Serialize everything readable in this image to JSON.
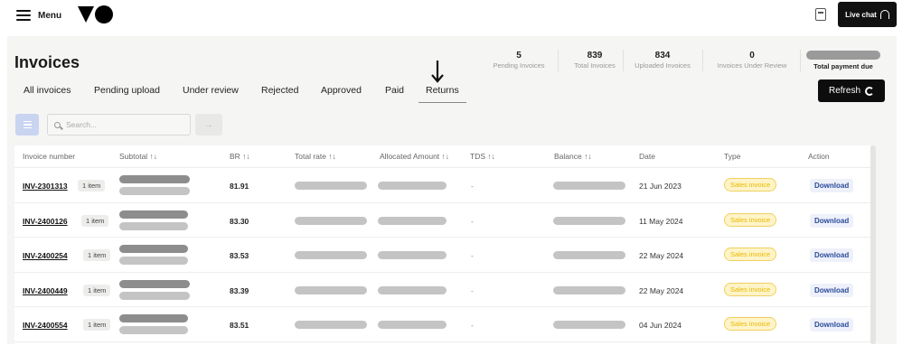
{
  "topbar": {
    "menu_label": "Menu",
    "live_chat_label": "Live chat"
  },
  "page": {
    "title": "Invoices"
  },
  "stats": [
    {
      "value": "5",
      "label": "Pending Invoices"
    },
    {
      "value": "839",
      "label": "Total Invoices"
    },
    {
      "value": "834",
      "label": "Uploaded Invoices"
    },
    {
      "value": "0",
      "label": "Invoices Under Review"
    }
  ],
  "total_payment_label": "Total payment due",
  "tabs": [
    {
      "label": "All invoices"
    },
    {
      "label": "Pending upload"
    },
    {
      "label": "Under review"
    },
    {
      "label": "Rejected"
    },
    {
      "label": "Approved"
    },
    {
      "label": "Paid"
    },
    {
      "label": "Returns"
    }
  ],
  "active_tab": "Returns",
  "refresh_label": "Refresh",
  "search": {
    "placeholder": "Search...",
    "go_icon": "arrow-right-icon"
  },
  "table": {
    "columns": [
      "Invoice number",
      "Subtotal ↑↓",
      "BR ↑↓",
      "Total rate ↑↓",
      "Allocated Amount ↑↓",
      "TDS ↑↓",
      "Balance ↑↓",
      "Date",
      "Type",
      "Action"
    ],
    "rows": [
      {
        "invoice": "INV-2301313",
        "items": "1 item",
        "br": "81.91",
        "tds": "-",
        "date": "21 Jun 2023",
        "type": "Sales invoice",
        "action": "Download"
      },
      {
        "invoice": "INV-2400126",
        "items": "1 item",
        "br": "83.30",
        "tds": "-",
        "date": "11 May 2024",
        "type": "Sales invoice",
        "action": "Download"
      },
      {
        "invoice": "INV-2400254",
        "items": "1 item",
        "br": "83.53",
        "tds": "-",
        "date": "22 May 2024",
        "type": "Sales invoice",
        "action": "Download"
      },
      {
        "invoice": "INV-2400449",
        "items": "1 item",
        "br": "83.39",
        "tds": "-",
        "date": "22 May 2024",
        "type": "Sales invoice",
        "action": "Download"
      },
      {
        "invoice": "INV-2400554",
        "items": "1 item",
        "br": "83.51",
        "tds": "-",
        "date": "04 Jun 2024",
        "type": "Sales invoice",
        "action": "Download"
      }
    ]
  },
  "colors": {
    "accent_dark": "#111111",
    "filter_button": "#c9d4f0",
    "type_badge": "#e6b800",
    "download": "#2a4a9a"
  }
}
